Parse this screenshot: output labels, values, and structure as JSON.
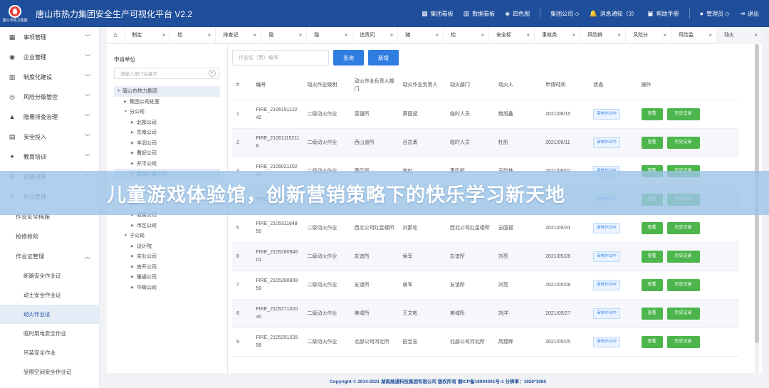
{
  "header": {
    "logo_text": "唐山市热力集团",
    "title": "唐山市热力集团安全生产可视化平台  V2.2",
    "nav": [
      {
        "icon": "dashboard-icon",
        "label": "集团看板"
      },
      {
        "icon": "chart-icon",
        "label": "数据看板"
      },
      {
        "icon": "cube-icon",
        "label": "四色图"
      },
      {
        "icon": "",
        "label": "集团公司 ◇"
      },
      {
        "icon": "bell-icon",
        "label": "消息通知（3）"
      },
      {
        "icon": "book-icon",
        "label": "帮助手册"
      },
      {
        "icon": "user-icon",
        "label": "管理员 ◇"
      },
      {
        "icon": "logout-icon",
        "label": "退出"
      }
    ]
  },
  "sidebar": {
    "menus": [
      {
        "icon": "grid-icon",
        "label": "事项管理"
      },
      {
        "icon": "settings-icon",
        "label": "企业管理"
      },
      {
        "icon": "building-icon",
        "label": "制度化建设"
      },
      {
        "icon": "target-icon",
        "label": "风险分级管控"
      },
      {
        "icon": "warning-icon",
        "label": "隐患排查治理"
      },
      {
        "icon": "calculator-icon",
        "label": "安全投入"
      },
      {
        "icon": "education-icon",
        "label": "教育培训"
      },
      {
        "icon": "gear-icon",
        "label": "设备设施"
      },
      {
        "icon": "wrench-icon",
        "label": "作业管理"
      }
    ],
    "submenus": [
      {
        "label": "作业安全措施"
      },
      {
        "label": "抢修抢险"
      },
      {
        "label": "作业证管理"
      }
    ],
    "permit_items": [
      "断路安全作业证",
      "动土安全作业证",
      "动火作业证",
      "临时用电安全作业",
      "吊装安全作业",
      "受限空间安全作业证"
    ]
  },
  "tabs": [
    {
      "label": "制定"
    },
    {
      "label": "检"
    },
    {
      "label": "排查记"
    },
    {
      "label": "隐"
    },
    {
      "label": "隐"
    },
    {
      "label": "追责问"
    },
    {
      "label": "随"
    },
    {
      "label": "检"
    },
    {
      "label": "安全标"
    },
    {
      "label": "事故类"
    },
    {
      "label": "风险辨"
    },
    {
      "label": "风险分"
    },
    {
      "label": "风险监"
    },
    {
      "label": "动火"
    }
  ],
  "units": {
    "title": "申请单位",
    "search_placeholder": "请输入部门关键字",
    "tree": [
      {
        "label": "唐山市热力集团",
        "level": 0,
        "arrow": "▼"
      },
      {
        "label": "集团公司处室",
        "level": 1,
        "arrow": "▶"
      },
      {
        "label": "分公司",
        "level": 1,
        "arrow": "▼"
      },
      {
        "label": "北部公司",
        "level": 2,
        "arrow": "▶"
      },
      {
        "label": "东南公司",
        "level": 2,
        "arrow": "▶"
      },
      {
        "label": "丰润公司",
        "level": 2,
        "arrow": "▶"
      },
      {
        "label": "曹妃公司",
        "level": 2,
        "arrow": "▶"
      },
      {
        "label": "开平公司",
        "level": 2,
        "arrow": "▶"
      },
      {
        "label": "能源计量公司",
        "level": 2,
        "arrow": "▶"
      },
      {
        "label": "",
        "level": 2,
        "arrow": ""
      },
      {
        "label": "",
        "level": 2,
        "arrow": ""
      },
      {
        "label": "",
        "level": 2,
        "arrow": ""
      },
      {
        "label": "收费公司",
        "level": 2,
        "arrow": "▶"
      },
      {
        "label": "市区公司",
        "level": 2,
        "arrow": "▶"
      },
      {
        "label": "子公司",
        "level": 1,
        "arrow": "▼"
      },
      {
        "label": "设计院",
        "level": 2,
        "arrow": "▶"
      },
      {
        "label": "实业公司",
        "level": 2,
        "arrow": "▶"
      },
      {
        "label": "房开公司",
        "level": 2,
        "arrow": "▶"
      },
      {
        "label": "暖通公司",
        "level": 2,
        "arrow": "▶"
      },
      {
        "label": "华辉公司",
        "level": 2,
        "arrow": "▶"
      }
    ]
  },
  "toolbar": {
    "search_placeholder": "作业证（票）编号",
    "query_label": "查询",
    "add_label": "新增"
  },
  "table": {
    "columns": [
      "#",
      "编号",
      "动火作业级别",
      "动火作业负责人部门",
      "动火作业负责人",
      "动火部门",
      "动火人",
      "申请时间",
      "状态",
      "操作"
    ],
    "view_label": "查看",
    "history_label": "历史记录",
    "rows": [
      {
        "no": "1",
        "id": "FIRE_210615112242",
        "level": "二级动火作业",
        "dept": "富强所",
        "leader": "蔡国斌",
        "fire_dept": "临时人员",
        "person": "樊旭鑫",
        "date": "2021/06/15",
        "status": "审核作业中"
      },
      {
        "no": "2",
        "id": "FIRE_210611152118",
        "level": "二级动火作业",
        "dept": "西山道所",
        "leader": "吕志勇",
        "fire_dept": "临时人员",
        "person": "杜凯",
        "date": "2021/06/11",
        "status": "审核作业中"
      },
      {
        "no": "3",
        "id": "FIRE_210602110234",
        "level": "二级动火作业",
        "dept": "惠民所",
        "leader": "谢虹",
        "fire_dept": "惠民所",
        "person": "王晓林",
        "date": "2021/06/02",
        "status": "审核作业中"
      },
      {
        "no": "4",
        "id": "FIRE_210601095",
        "level": "",
        "dept": "",
        "leader": "",
        "fire_dept": "",
        "person": "",
        "date": "",
        "status": "审核作业中"
      },
      {
        "no": "5",
        "id": "FIRE_210531164850",
        "level": "二级动火作业",
        "dept": "西北公司红星楼所",
        "leader": "刘那松",
        "fire_dept": "西北公司红星楼所",
        "person": "云国福",
        "date": "2021/05/31",
        "status": "审核作业中"
      },
      {
        "no": "6",
        "id": "FIRE_210528094601",
        "level": "二级动火作业",
        "dept": "友谊所",
        "leader": "侯军",
        "fire_dept": "友谊所",
        "person": "刘亮",
        "date": "2021/05/28",
        "status": "审核作业中"
      },
      {
        "no": "7",
        "id": "FIRE_210528090850",
        "level": "二级动火作业",
        "dept": "友谊所",
        "leader": "侯军",
        "fire_dept": "友谊所",
        "person": "刘亮",
        "date": "2021/05/28",
        "status": "审核作业中"
      },
      {
        "no": "8",
        "id": "FIRE_210527102040",
        "level": "二级动火作业",
        "dept": "美域所",
        "leader": "王文彬",
        "fire_dept": "美域所",
        "person": "刘洋",
        "date": "2021/05/27",
        "status": "审核作业中"
      },
      {
        "no": "9",
        "id": "FIRE_210525153558",
        "level": "二级动火作业",
        "dept": "北部公司河北所",
        "leader": "田宝忠",
        "fire_dept": "北部公司河北所",
        "person": "高建辉",
        "date": "2021/05/25",
        "status": "审核作业中"
      }
    ]
  },
  "footer": {
    "text": "Copyright © 2014-2021 湖南展通科技集团有限公司 版权所有 湘ICP备18004301号-1  分辨率：1920*1080"
  },
  "banner": {
    "text": "儿童游戏体验馆，创新营销策略下的快乐学习新天地"
  }
}
